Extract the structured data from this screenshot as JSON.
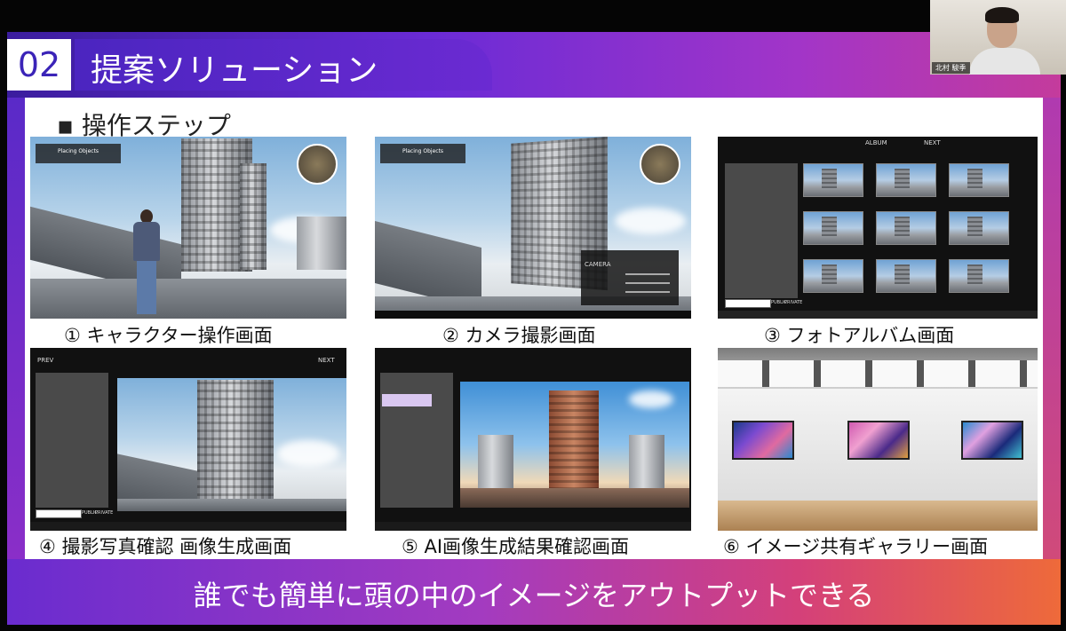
{
  "slide": {
    "section_number": "02",
    "section_title": "提案ソリューション",
    "bullet_title": "▪ 操作ステップ",
    "footer_text": "誰でも簡単に頭の中のイメージをアウトプットできる"
  },
  "steps": [
    {
      "caption": "① キャラクター操作画面"
    },
    {
      "caption": "② カメラ撮影画面"
    },
    {
      "caption": "③ フォトアルバム画面"
    },
    {
      "caption": "④ 撮影写真確認 画像生成画面"
    },
    {
      "caption": "⑤ AI画像生成結果確認画面"
    },
    {
      "caption": "⑥ イメージ共有ギャラリー画面"
    }
  ],
  "screens": {
    "hud_label": "Placing Objects",
    "camera_panel_label": "CAMERA",
    "album_title": "ALBUM",
    "album_next": "NEXT",
    "prev_label": "PREV",
    "next_label": "NEXT",
    "public_label": "PUBLIC",
    "private_label": "PRIVATE"
  },
  "webcam": {
    "name": "北村 駿季"
  }
}
